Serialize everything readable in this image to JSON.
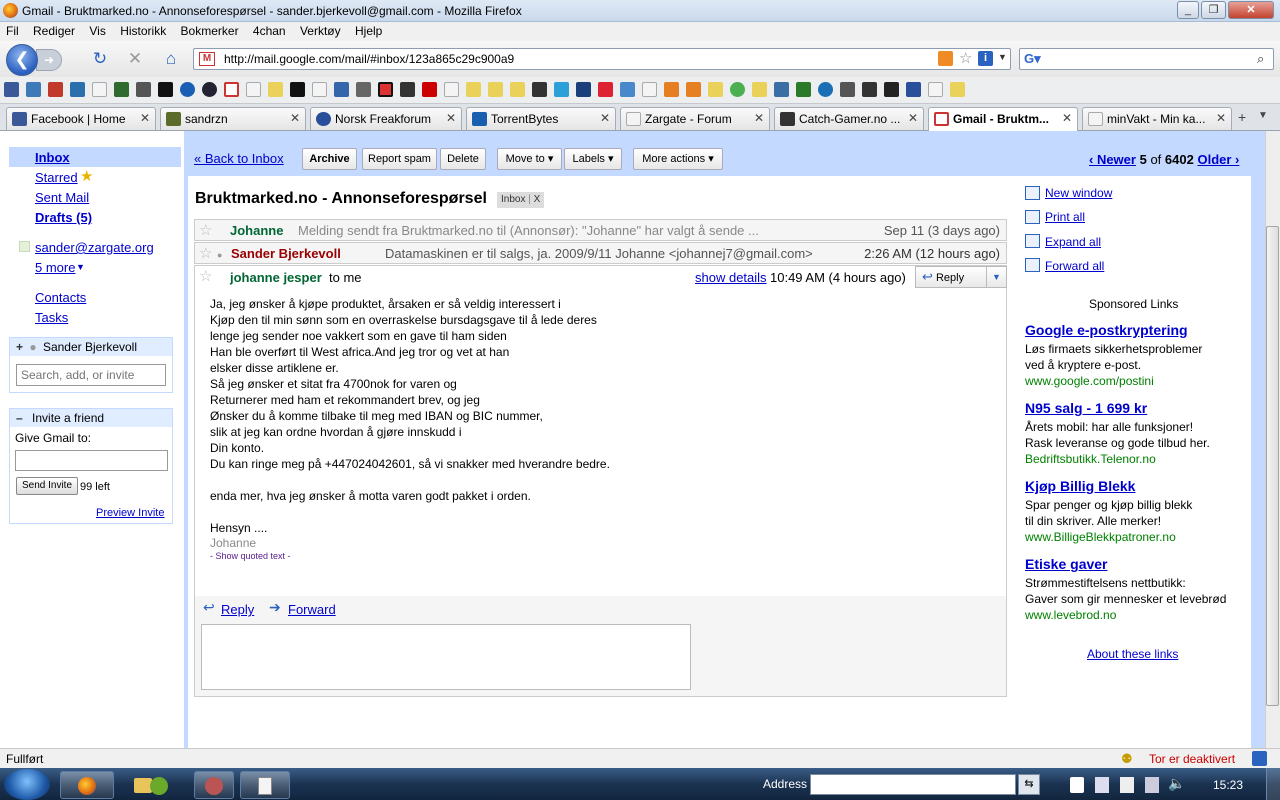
{
  "window": {
    "title": "Gmail - Bruktmarked.no - Annonseforespørsel - sander.bjerkevoll@gmail.com - Mozilla Firefox"
  },
  "menu": [
    "Fil",
    "Rediger",
    "Vis",
    "Historikk",
    "Bokmerker",
    "4chan",
    "Verktøy",
    "Hjelp"
  ],
  "address": {
    "url": "http://mail.google.com/mail/#inbox/123a865c29c900a9"
  },
  "tabs": [
    {
      "label": "Facebook | Home",
      "color": "#3b5998"
    },
    {
      "label": "sandrzn",
      "color": "#5a6b2c"
    },
    {
      "label": "Norsk Freakforum",
      "color": "#2a4f9a"
    },
    {
      "label": "TorrentBytes",
      "color": "#1a5eb0"
    },
    {
      "label": "Zargate - Forum",
      "color": "#dddddd"
    },
    {
      "label": "Catch-Gamer.no ...",
      "color": "#333333"
    },
    {
      "label": "Gmail - Bruktm...",
      "color": "#cc3333"
    },
    {
      "label": "minVakt - Min ka...",
      "color": "#dddddd"
    }
  ],
  "leftnav": {
    "inbox": "Inbox",
    "starred": "Starred",
    "sent": "Sent Mail",
    "drafts": "Drafts (5)",
    "label_email": "sander@zargate.org",
    "more": "5 more",
    "contacts": "Contacts",
    "tasks": "Tasks",
    "chat_user": "Sander Bjerkevoll",
    "chat_search_placeholder": "Search, add, or invite",
    "invite_title": "Invite a friend",
    "invite_label": "Give Gmail to:",
    "invite_button": "Send Invite",
    "invite_left": "99 left",
    "invite_preview": "Preview Invite"
  },
  "toolbar": {
    "back": "« Back to Inbox",
    "archive": "Archive",
    "spam": "Report spam",
    "delete": "Delete",
    "moveto": "Move to",
    "labels": "Labels",
    "moreactions": "More actions",
    "newer": "‹ Newer",
    "position": "5",
    "of": "of",
    "total": "6402",
    "older": "Older ›"
  },
  "thread": {
    "subject": "Bruktmarked.no - Annonseforespørsel",
    "label": "Inbox",
    "label_x": "X",
    "messages": [
      {
        "sender": "Johanne",
        "snippet": "Melding sendt fra Bruktmarked.no til (Annonsør): \"Johanne\" har valgt å sende ...",
        "date": "Sep 11 (3 days ago)"
      },
      {
        "sender": "Sander Bjerkevoll",
        "snippet": "Datamaskinen er til salgs, ja. 2009/9/11 Johanne <johannej7@gmail.com>",
        "date": "2:26 AM (12 hours ago)"
      }
    ],
    "open": {
      "sender": "johanne jesper",
      "to": "to me",
      "show_details": "show details",
      "time": "10:49 AM (4 hours ago)",
      "reply": "Reply",
      "body": [
        "Ja, jeg ønsker å kjøpe produktet, årsaken er så veldig interessert i",
        "Kjøp den til min sønn som en overraskelse bursdagsgave til å lede deres",
        "lenge jeg sender noe vakkert som en gave til ham siden",
        "Han ble overført til West africa.And jeg tror og vet at han",
        "elsker disse artiklene er.",
        "Så jeg ønsker et sitat fra 4700nok for varen og",
        "Returnerer med ham et rekommandert brev, og jeg",
        "Ønsker du å komme tilbake til meg med IBAN og BIC nummer,",
        "slik at jeg kan ordne hvordan å gjøre innskudd i",
        "Din konto.",
        "Du kan ringe meg på +447024042601, så vi snakker med hverandre bedre."
      ],
      "body2": "enda mer, hva jeg ønsker å motta varen godt pakket i orden.",
      "signoff": "Hensyn ....",
      "signature": "Johanne",
      "quoted": "- Show quoted text -"
    },
    "reply_link": "Reply",
    "forward_link": "Forward"
  },
  "rightpanel": {
    "new_window": "New window",
    "print_all": "Print all",
    "expand_all": "Expand all",
    "forward_all": "Forward all",
    "sponsored": "Sponsored Links",
    "ads": [
      {
        "title": "Google e-postkryptering",
        "l1": "Løs firmaets sikkerhetsproblemer",
        "l2": "ved å kryptere e-post.",
        "url": "www.google.com/postini"
      },
      {
        "title": "N95 salg - 1 699 kr",
        "l1": "Årets mobil: har alle funksjoner!",
        "l2": "Rask leveranse og gode tilbud her.",
        "url": "Bedriftsbutikk.Telenor.no"
      },
      {
        "title": "Kjøp Billig Blekk",
        "l1": "Spar penger og kjøp billig blekk",
        "l2": "til din skriver. Alle merker!",
        "url": "www.BilligeBlekkpatroner.no"
      },
      {
        "title": "Etiske gaver",
        "l1": "Strømmestiftelsens nettbutikk:",
        "l2": "Gaver som gir mennesker et levebrød",
        "url": "www.levebrod.no"
      }
    ],
    "about": "About these links"
  },
  "status": {
    "left": "Fullført",
    "tor": "Tor er deaktivert"
  },
  "taskbar": {
    "address_label": "Address",
    "clock": "15:23"
  },
  "colors": {
    "gmail_blue": "#c3d9ff",
    "link": "#0000cc",
    "green": "#006633",
    "sender_red": "#990000"
  }
}
